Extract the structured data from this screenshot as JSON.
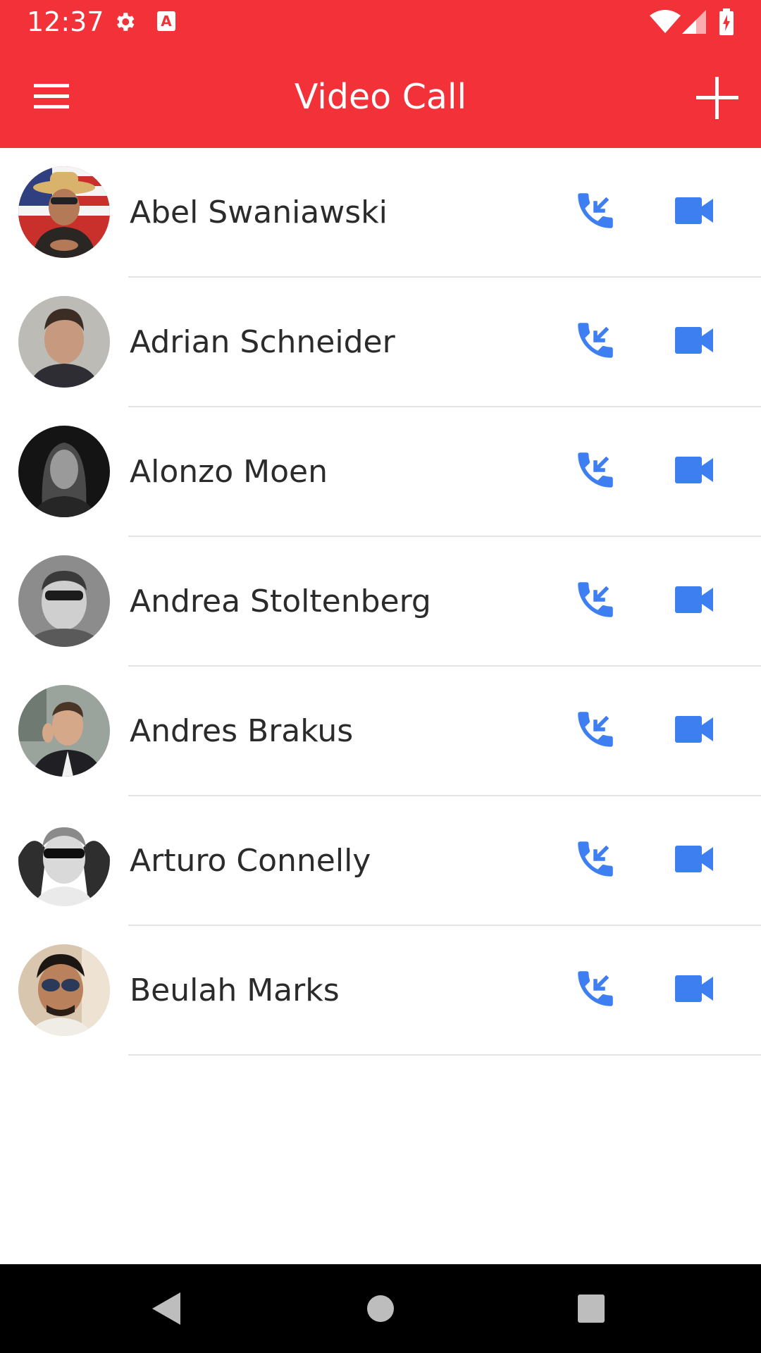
{
  "status_bar": {
    "time": "12:37",
    "icons": [
      "settings-gear-icon",
      "keyboard-a-icon",
      "wifi-icon",
      "cell-signal-icon",
      "battery-charging-icon"
    ]
  },
  "app_bar": {
    "title": "Video Call",
    "menu_icon": "hamburger-menu-icon",
    "add_icon": "plus-icon",
    "background_color": "#f23139"
  },
  "contacts": [
    {
      "name": "Abel Swaniawski",
      "call_icon": "phone-incoming-icon",
      "video_icon": "videocam-icon"
    },
    {
      "name": "Adrian Schneider",
      "call_icon": "phone-incoming-icon",
      "video_icon": "videocam-icon"
    },
    {
      "name": "Alonzo Moen",
      "call_icon": "phone-incoming-icon",
      "video_icon": "videocam-icon"
    },
    {
      "name": "Andrea Stoltenberg",
      "call_icon": "phone-incoming-icon",
      "video_icon": "videocam-icon"
    },
    {
      "name": "Andres Brakus",
      "call_icon": "phone-incoming-icon",
      "video_icon": "videocam-icon"
    },
    {
      "name": "Arturo Connelly",
      "call_icon": "phone-incoming-icon",
      "video_icon": "videocam-icon"
    },
    {
      "name": "Beulah Marks",
      "call_icon": "phone-incoming-icon",
      "video_icon": "videocam-icon"
    }
  ],
  "accent_color": "#3d7ff0",
  "nav_bar": {
    "icons": [
      "back-triangle-icon",
      "home-circle-icon",
      "recents-square-icon"
    ]
  }
}
